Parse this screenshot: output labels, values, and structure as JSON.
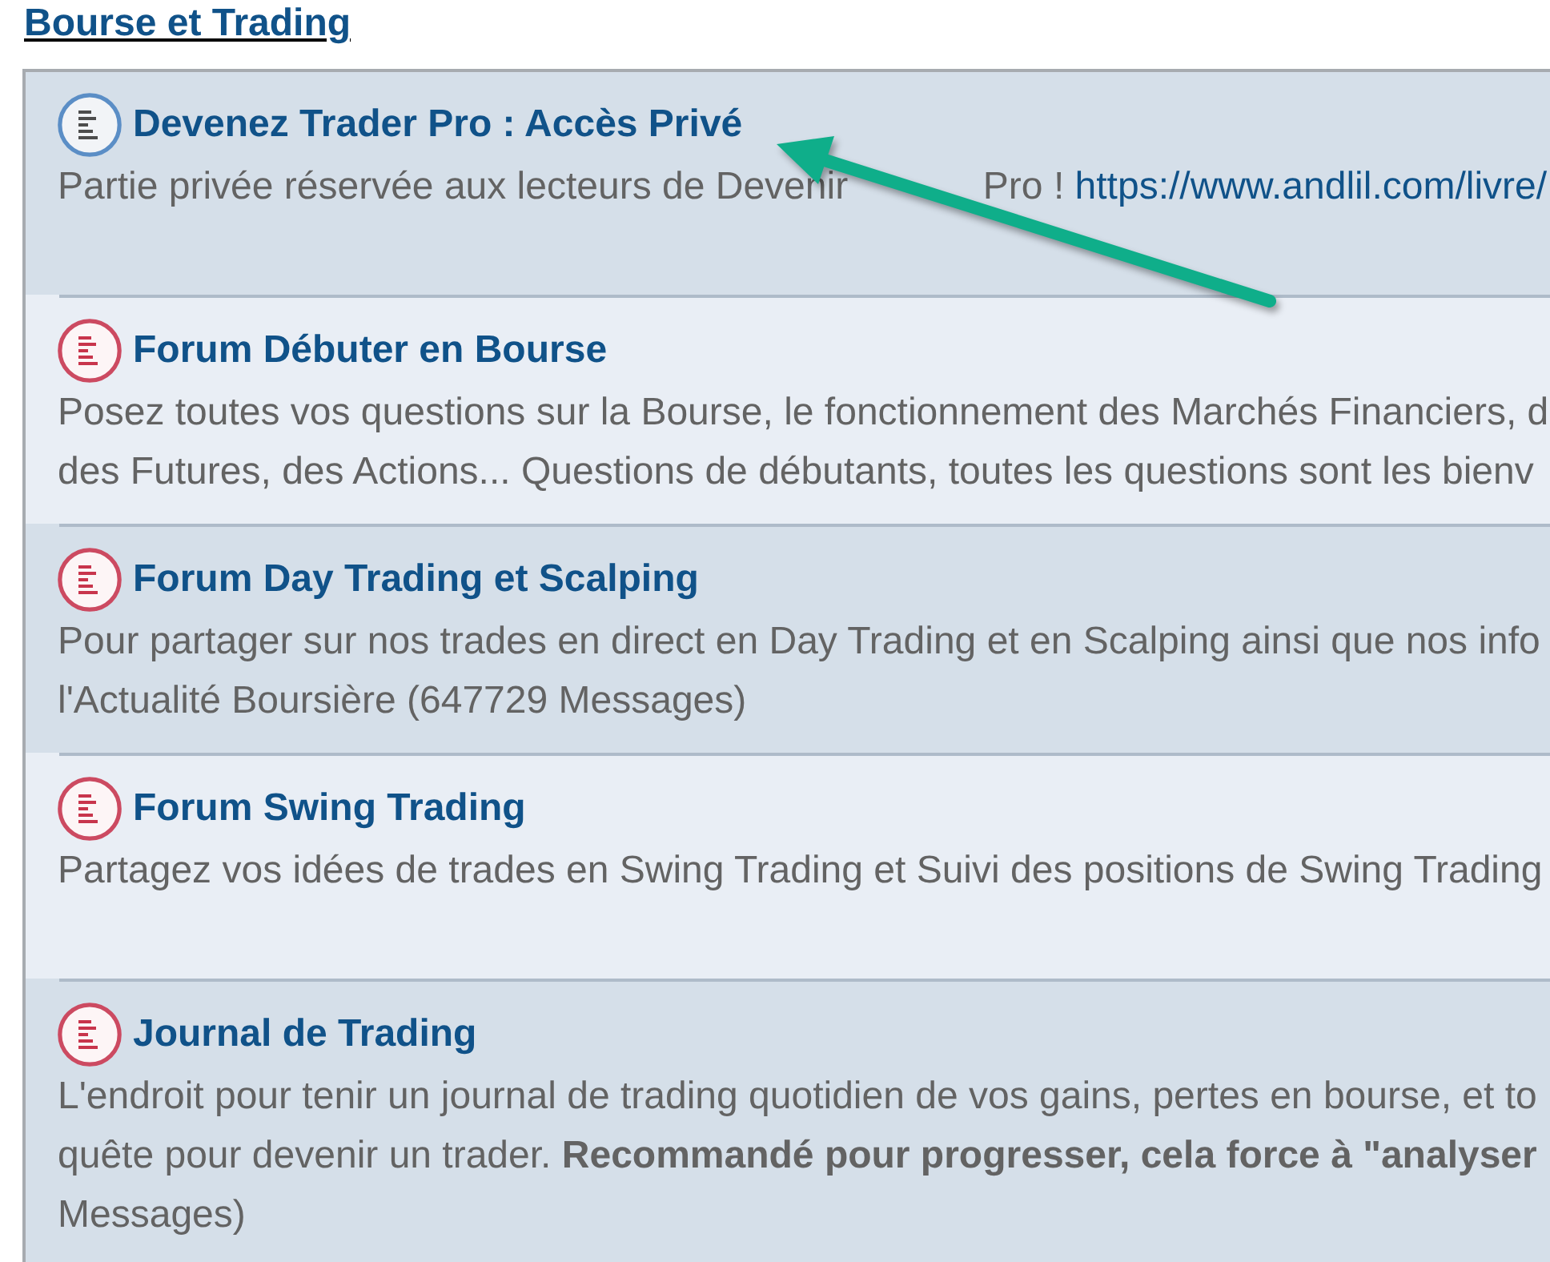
{
  "category": {
    "title": "Bourse et Trading"
  },
  "forums": [
    {
      "title": "Devenez Trader Pro : Accès Privé",
      "unread": false,
      "description_lines": [
        "Partie privée réservée aux lecteurs de Devenir"
      ],
      "text_after_arrow": "Pro !",
      "link": "https://www.andlil.com/livre/"
    },
    {
      "title": "Forum Débuter en Bourse",
      "unread": true,
      "description_lines": [
        "Posez toutes vos questions sur la Bourse, le fonctionnement des Marchés Financiers, d",
        "des Futures, des Actions... Questions de débutants, toutes les questions sont les bienv"
      ]
    },
    {
      "title": "Forum Day Trading et Scalping",
      "unread": true,
      "description_lines": [
        "Pour partager sur nos trades en direct en Day Trading et en Scalping ainsi que nos info",
        "l'Actualité Boursière (647729 Messages)"
      ]
    },
    {
      "title": "Forum Swing Trading",
      "unread": true,
      "description_lines": [
        "Partagez vos idées de trades en Swing Trading et Suivi des positions de Swing Trading"
      ]
    },
    {
      "title": "Journal de Trading",
      "unread": true,
      "description_lines": [
        "L'endroit pour tenir un journal de trading quotidien de vos gains, pertes en bourse, et to",
        "quête pour devenir un trader. **Recommandé pour progresser, cela force à \"analyser**",
        "Messages)"
      ]
    }
  ]
}
